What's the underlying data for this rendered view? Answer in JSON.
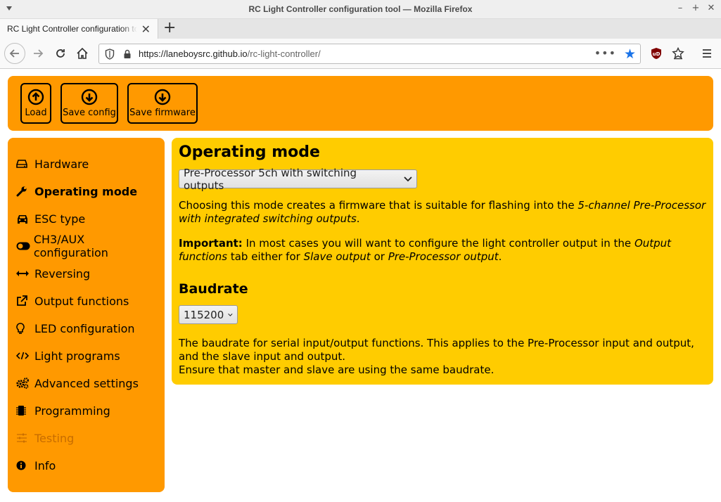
{
  "window": {
    "title": "RC Light Controller configuration tool — Mozilla Firefox"
  },
  "tab": {
    "label": "RC Light Controller configuration tool"
  },
  "navbar": {
    "url_domain": "https://laneboysrc.github.io",
    "url_path": "/rc-light-controller/"
  },
  "toolbar": {
    "load_label": "Load",
    "save_config_label": "Save config",
    "save_firmware_label": "Save firmware"
  },
  "sidebar": {
    "items": [
      {
        "label": "Hardware",
        "icon": "hdd-icon"
      },
      {
        "label": "Operating mode",
        "icon": "wrench-icon",
        "active": true
      },
      {
        "label": "ESC type",
        "icon": "car-icon"
      },
      {
        "label": "CH3/AUX configuration",
        "icon": "toggle-icon"
      },
      {
        "label": "Reversing",
        "icon": "arrows-h-icon"
      },
      {
        "label": "Output functions",
        "icon": "external-link-icon"
      },
      {
        "label": "LED configuration",
        "icon": "lightbulb-icon"
      },
      {
        "label": "Light programs",
        "icon": "code-icon"
      },
      {
        "label": "Advanced settings",
        "icon": "cogs-icon"
      },
      {
        "label": "Programming",
        "icon": "chip-icon"
      },
      {
        "label": "Testing",
        "icon": "sliders-icon",
        "disabled": true
      },
      {
        "label": "Info",
        "icon": "info-icon"
      }
    ]
  },
  "content": {
    "mode_heading": "Operating mode",
    "mode_selected": "Pre-Processor 5ch with switching outputs",
    "mode_desc_pre": "Choosing this mode creates a firmware that is suitable for flashing into the ",
    "mode_desc_em": "5-channel Pre-Processor with integrated switching outputs",
    "mode_desc_post": ".",
    "important_label": "Important:",
    "important_1": " In most cases you will want to configure the light controller output in the ",
    "important_em1": "Output functions",
    "important_2": " tab either for ",
    "important_em2": "Slave output",
    "important_3": " or ",
    "important_em3": "Pre-Processor output",
    "important_4": ".",
    "baud_heading": "Baudrate",
    "baud_selected": "115200",
    "baud_desc_1": "The baudrate for serial input/output functions. This applies to the Pre-Processor input and output, and the slave input and output.",
    "baud_desc_2": "Ensure that master and slave are using the same baudrate."
  },
  "colors": {
    "accent_orange": "#ff9900",
    "content_yellow": "#ffcc00",
    "star_blue": "#1a73e8",
    "ublock_red": "#800000"
  }
}
